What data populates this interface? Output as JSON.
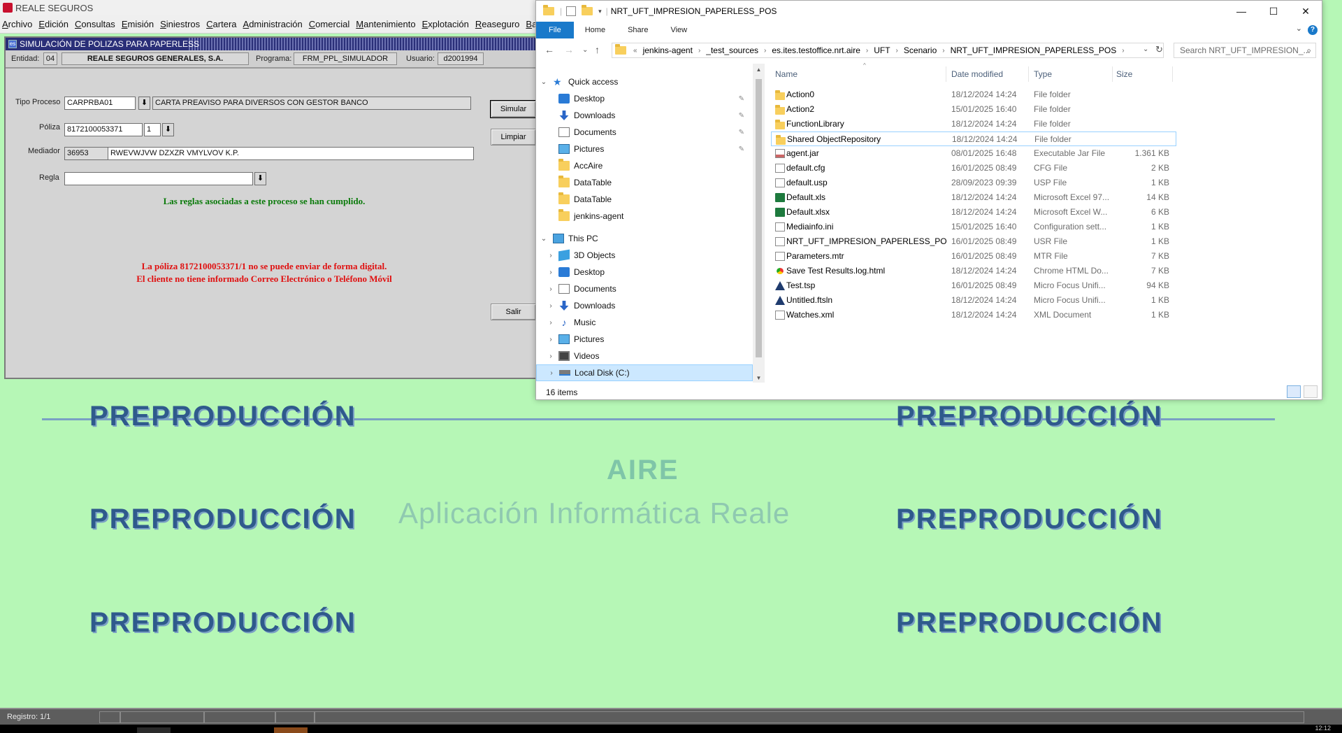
{
  "app": {
    "title": "REALE SEGUROS",
    "menu": [
      "Archivo",
      "Edición",
      "Consultas",
      "Emisión",
      "Siniestros",
      "Cartera",
      "Administración",
      "Comercial",
      "Mantenimiento",
      "Explotación",
      "Reaseguro",
      "Banc"
    ]
  },
  "form": {
    "caption": "SIMULACIÓN DE POLIZAS PARA PAPERLESS",
    "header": {
      "entidad_label": "Entidad:",
      "entidad_code": "04",
      "entidad_name": "REALE SEGUROS GENERALES, S.A.",
      "programa_label": "Programa:",
      "programa": "FRM_PPL_SIMULADOR",
      "usuario_label": "Usuario:",
      "usuario": "d2001994"
    },
    "tipo_proceso_label": "Tipo Proceso",
    "tipo_proceso_code": "CARPRBA01",
    "tipo_proceso_desc": "CARTA PREAVISO PARA DIVERSOS CON GESTOR BANCO",
    "poliza_label": "Póliza",
    "poliza": "8172100053371",
    "poliza_suffix": "1",
    "mediador_label": "Mediador",
    "mediador_code": "36953",
    "mediador_name": "RWEVWJVW DZXZR VMYLVOV K.P.",
    "regla_label": "Regla",
    "regla": "",
    "btn_simular": "Simular",
    "btn_limpiar": "Limpiar",
    "btn_salir": "Salir",
    "msg_ok": "Las reglas asociadas a este proceso se han cumplido.",
    "msg_err1": "La póliza 8172100053371/1 no se puede enviar de forma digital.",
    "msg_err2": "El cliente no tiene informado Correo Electrónico o Teléfono Móvil"
  },
  "watermark": {
    "pre": "PREPRODUCCIÓN",
    "aire": "AIRE",
    "sub": "Aplicación Informática Reale"
  },
  "status": {
    "registro": "Registro: 1/1",
    "clock": "12:12"
  },
  "explorer": {
    "title": "NRT_UFT_IMPRESION_PAPERLESS_POS",
    "ribbon": [
      "File",
      "Home",
      "Share",
      "View"
    ],
    "breadcrumb": [
      "jenkins-agent",
      "_test_sources",
      "es.ites.testoffice.nrt.aire",
      "UFT",
      "Scenario",
      "NRT_UFT_IMPRESION_PAPERLESS_POS"
    ],
    "search_placeholder": "Search NRT_UFT_IMPRESION_...",
    "nav": {
      "quick_access": "Quick access",
      "qa_items": [
        "Desktop",
        "Downloads",
        "Documents",
        "Pictures",
        "AccAire",
        "DataTable",
        "DataTable",
        "jenkins-agent"
      ],
      "this_pc": "This PC",
      "pc_items": [
        "3D Objects",
        "Desktop",
        "Documents",
        "Downloads",
        "Music",
        "Pictures",
        "Videos",
        "Local Disk (C:)"
      ]
    },
    "columns": [
      "Name",
      "Date modified",
      "Type",
      "Size"
    ],
    "files": [
      {
        "name": "Action0",
        "date": "18/12/2024 14:24",
        "type": "File folder",
        "size": "",
        "icon": "folder"
      },
      {
        "name": "Action2",
        "date": "15/01/2025 16:40",
        "type": "File folder",
        "size": "",
        "icon": "folder"
      },
      {
        "name": "FunctionLibrary",
        "date": "18/12/2024 14:24",
        "type": "File folder",
        "size": "",
        "icon": "folder"
      },
      {
        "name": "Shared ObjectRepository",
        "date": "18/12/2024 14:24",
        "type": "File folder",
        "size": "",
        "icon": "folder"
      },
      {
        "name": "agent.jar",
        "date": "08/01/2025 16:48",
        "type": "Executable Jar File",
        "size": "1.361 KB",
        "icon": "jar"
      },
      {
        "name": "default.cfg",
        "date": "16/01/2025 08:49",
        "type": "CFG File",
        "size": "2 KB",
        "icon": "doc"
      },
      {
        "name": "default.usp",
        "date": "28/09/2023 09:39",
        "type": "USP File",
        "size": "1 KB",
        "icon": "doc"
      },
      {
        "name": "Default.xls",
        "date": "18/12/2024 14:24",
        "type": "Microsoft Excel 97...",
        "size": "14 KB",
        "icon": "xls"
      },
      {
        "name": "Default.xlsx",
        "date": "18/12/2024 14:24",
        "type": "Microsoft Excel W...",
        "size": "6 KB",
        "icon": "xls"
      },
      {
        "name": "Mediainfo.ini",
        "date": "15/01/2025 16:40",
        "type": "Configuration sett...",
        "size": "1 KB",
        "icon": "doc"
      },
      {
        "name": "NRT_UFT_IMPRESION_PAPERLESS_POS.usr",
        "date": "16/01/2025 08:49",
        "type": "USR File",
        "size": "1 KB",
        "icon": "doc"
      },
      {
        "name": "Parameters.mtr",
        "date": "16/01/2025 08:49",
        "type": "MTR File",
        "size": "7 KB",
        "icon": "doc"
      },
      {
        "name": "Save Test Results.log.html",
        "date": "18/12/2024 14:24",
        "type": "Chrome HTML Do...",
        "size": "7 KB",
        "icon": "chrome"
      },
      {
        "name": "Test.tsp",
        "date": "16/01/2025 08:49",
        "type": "Micro Focus Unifi...",
        "size": "94 KB",
        "icon": "tsp"
      },
      {
        "name": "Untitled.ftsln",
        "date": "18/12/2024 14:24",
        "type": "Micro Focus Unifi...",
        "size": "1 KB",
        "icon": "tsp"
      },
      {
        "name": "Watches.xml",
        "date": "18/12/2024 14:24",
        "type": "XML Document",
        "size": "1 KB",
        "icon": "doc"
      }
    ],
    "item_count": "16 items"
  }
}
